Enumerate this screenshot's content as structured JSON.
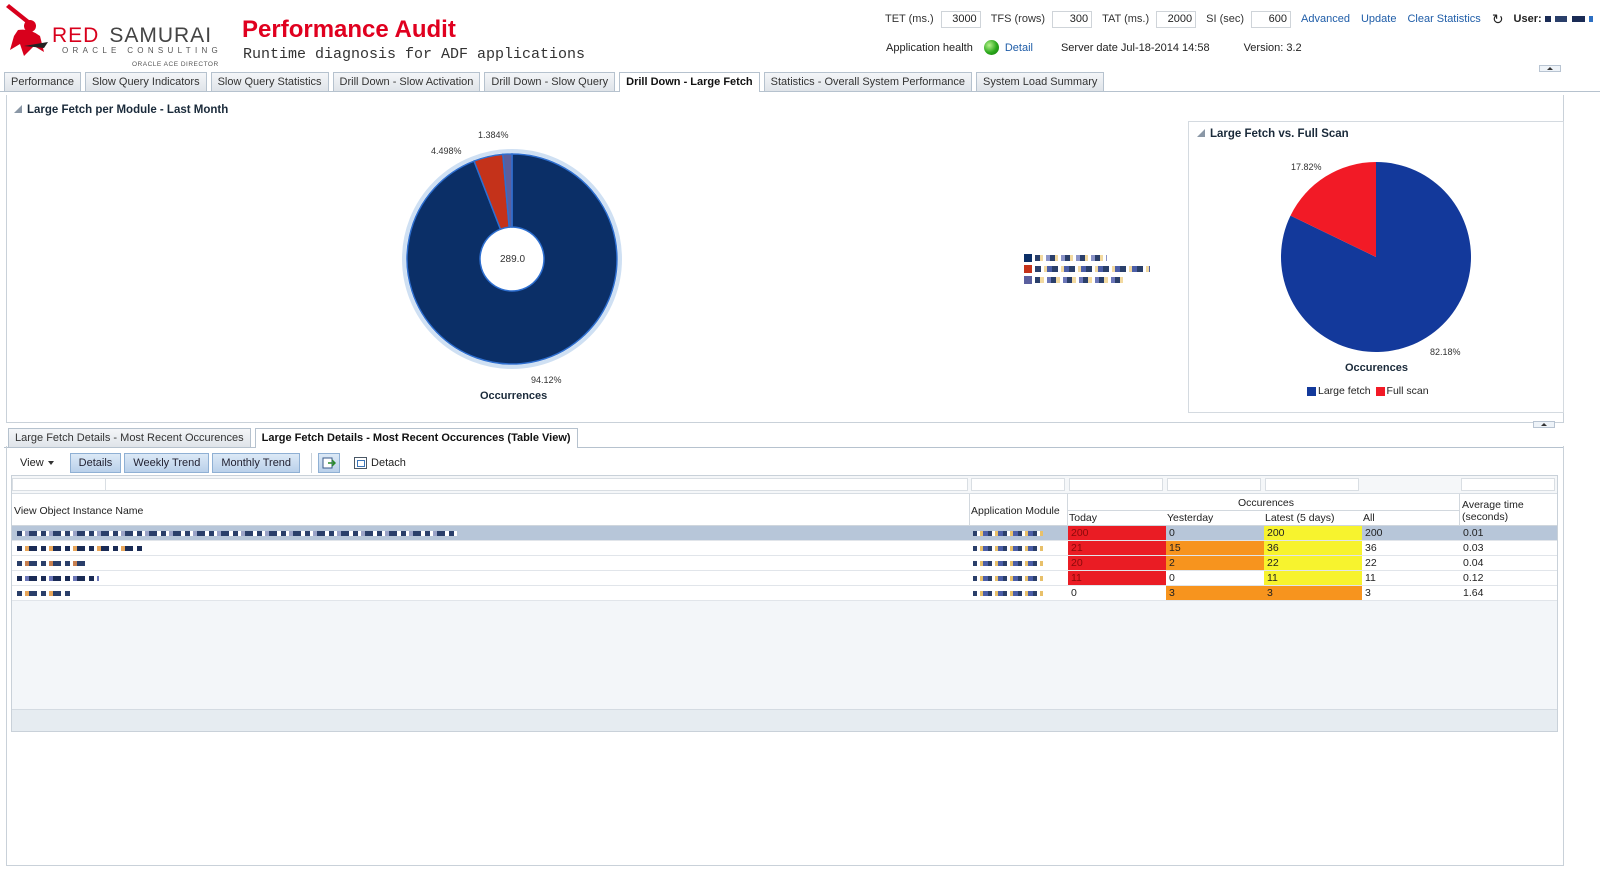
{
  "brand": {
    "name_red": "RED",
    "name_dark": "SAMURAI",
    "tagline": "ORACLE CONSULTING",
    "badge": "ORACLE ACE DIRECTOR"
  },
  "header": {
    "title": "Performance Audit",
    "subtitle": "Runtime diagnosis for ADF applications"
  },
  "params": {
    "tet_label": "TET (ms.)",
    "tet_value": "3000",
    "tfs_label": "TFS (rows)",
    "tfs_value": "300",
    "tat_label": "TAT (ms.)",
    "tat_value": "2000",
    "si_label": "SI (sec)",
    "si_value": "600",
    "advanced": "Advanced",
    "update": "Update",
    "clear": "Clear Statistics",
    "user_label": "User:"
  },
  "status": {
    "health_label": "Application health",
    "health_color": "#2aa71a",
    "detail_link": "Detail",
    "server_date": "Server date  Jul-18-2014 14:58",
    "version": "Version: 3.2"
  },
  "tabs": [
    {
      "label": "Performance"
    },
    {
      "label": "Slow Query Indicators"
    },
    {
      "label": "Slow Query Statistics"
    },
    {
      "label": "Drill Down - Slow Activation"
    },
    {
      "label": "Drill Down - Slow Query"
    },
    {
      "label": "Drill Down - Large Fetch"
    },
    {
      "label": "Statistics - Overall System Performance"
    },
    {
      "label": "System Load Summary"
    }
  ],
  "active_tab": 5,
  "chart_data": [
    {
      "type": "pie",
      "title": "Large Fetch per Module - Last Month",
      "caption": "Occurrences",
      "center_label": "289.0",
      "slices": [
        {
          "label_pct": "94.12%",
          "value": 94.12,
          "color": "#0b2f67"
        },
        {
          "label_pct": "4.498%",
          "value": 4.498,
          "color": "#c4321a"
        },
        {
          "label_pct": "1.384%",
          "value": 1.384,
          "color": "#5a5f9e"
        }
      ]
    },
    {
      "type": "pie",
      "title": "Large Fetch vs. Full Scan",
      "caption": "Occurences",
      "slices": [
        {
          "name": "Large fetch",
          "label_pct": "82.18%",
          "value": 82.18,
          "color": "#13399b"
        },
        {
          "name": "Full scan",
          "label_pct": "17.82%",
          "value": 17.82,
          "color": "#f21a26"
        }
      ]
    }
  ],
  "detail_tabs": [
    {
      "label": "Large Fetch Details - Most Recent Occurences"
    },
    {
      "label": "Large Fetch Details - Most Recent Occurences (Table View)"
    }
  ],
  "active_detail_tab": 1,
  "toolbar": {
    "view": "View",
    "details": "Details",
    "weekly": "Weekly Trend",
    "monthly": "Monthly Trend",
    "detach": "Detach"
  },
  "table": {
    "col_name": "View Object Instance Name",
    "col_module": "Application Module",
    "col_group": "Occurences",
    "col_today": "Today",
    "col_yesterday": "Yesterday",
    "col_latest": "Latest (5 days)",
    "col_all": "All",
    "col_avg": "Average time (seconds)",
    "rows": [
      {
        "today": "200",
        "yesterday": "0",
        "latest": "200",
        "all": "200",
        "avg": "0.01"
      },
      {
        "today": "21",
        "yesterday": "15",
        "latest": "36",
        "all": "36",
        "avg": "0.03"
      },
      {
        "today": "20",
        "yesterday": "2",
        "latest": "22",
        "all": "22",
        "avg": "0.04"
      },
      {
        "today": "11",
        "yesterday": "0",
        "latest": "11",
        "all": "11",
        "avg": "0.12"
      },
      {
        "today": "0",
        "yesterday": "3",
        "latest": "3",
        "all": "3",
        "avg": "1.64"
      }
    ]
  }
}
